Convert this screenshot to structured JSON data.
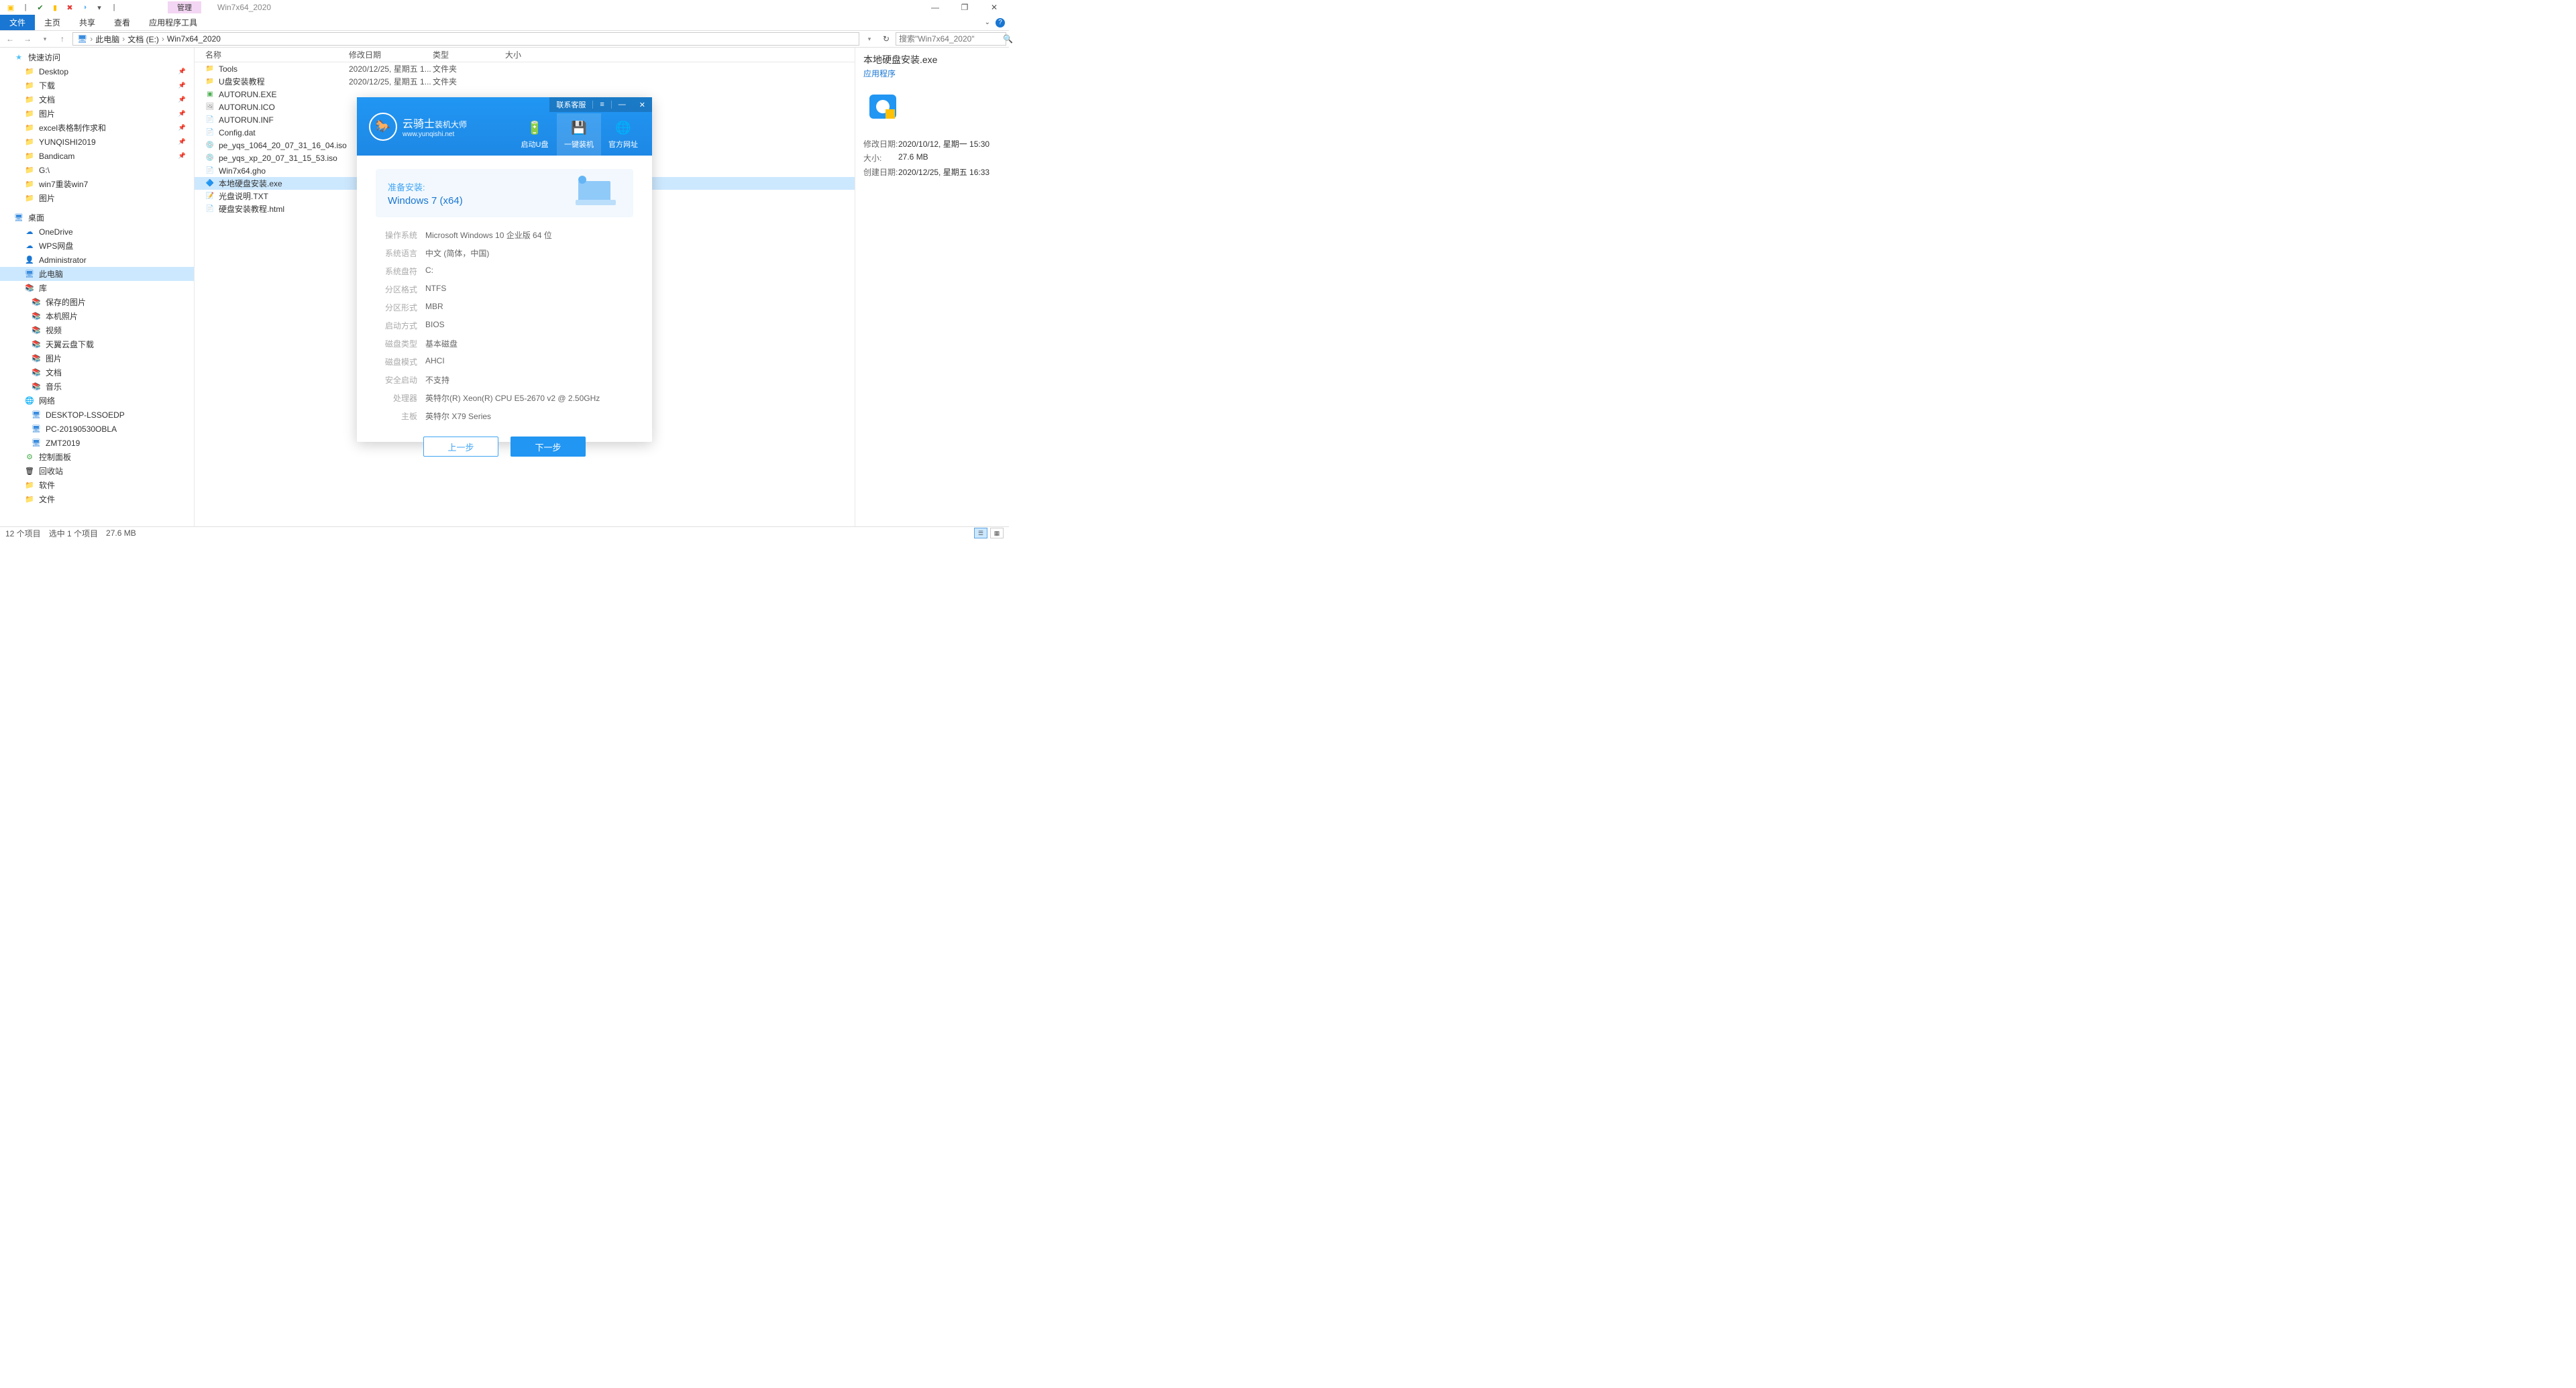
{
  "window": {
    "manage_tab": "管理",
    "title": "Win7x64_2020",
    "controls": {
      "minimize": "—",
      "maximize": "❐",
      "close": "✕"
    }
  },
  "ribbon": {
    "file": "文件",
    "home": "主页",
    "share": "共享",
    "view": "查看",
    "apptools": "应用程序工具"
  },
  "breadcrumb": {
    "pc": "此电脑",
    "drive": "文档 (E:)",
    "folder": "Win7x64_2020"
  },
  "search": {
    "placeholder": "搜索\"Win7x64_2020\""
  },
  "columns": {
    "name": "名称",
    "date": "修改日期",
    "type": "类型",
    "size": "大小"
  },
  "nav": {
    "quick": "快速访问",
    "quick_items": [
      {
        "label": "Desktop",
        "pin": true
      },
      {
        "label": "下载",
        "pin": true
      },
      {
        "label": "文档",
        "pin": true
      },
      {
        "label": "图片",
        "pin": true
      },
      {
        "label": "excel表格制作求和",
        "pin": true
      },
      {
        "label": "YUNQISHI2019",
        "pin": true
      },
      {
        "label": "Bandicam",
        "pin": true
      },
      {
        "label": "G:\\",
        "pin": false
      },
      {
        "label": "win7重装win7",
        "pin": false
      },
      {
        "label": "图片",
        "pin": false
      }
    ],
    "desktop": "桌面",
    "desktop_items": [
      "OneDrive",
      "WPS网盘",
      "Administrator",
      "此电脑",
      "库"
    ],
    "lib_items": [
      "保存的图片",
      "本机照片",
      "视频",
      "天翼云盘下载",
      "图片",
      "文档",
      "音乐"
    ],
    "network": "网络",
    "network_items": [
      "DESKTOP-LSSOEDP",
      "PC-20190530OBLA",
      "ZMT2019"
    ],
    "control_panel": "控制面板",
    "recycle": "回收站",
    "software": "软件",
    "files": "文件"
  },
  "files": [
    {
      "name": "Tools",
      "date": "2020/12/25, 星期五 1...",
      "type": "文件夹",
      "size": "",
      "icon": "folder"
    },
    {
      "name": "U盘安装教程",
      "date": "2020/12/25, 星期五 1...",
      "type": "文件夹",
      "size": "",
      "icon": "folder"
    },
    {
      "name": "AUTORUN.EXE",
      "date": "",
      "type": "",
      "size": "",
      "icon": "exe-green"
    },
    {
      "name": "AUTORUN.ICO",
      "date": "",
      "type": "",
      "size": "",
      "icon": "ico"
    },
    {
      "name": "AUTORUN.INF",
      "date": "",
      "type": "",
      "size": "",
      "icon": "inf"
    },
    {
      "name": "Config.dat",
      "date": "",
      "type": "",
      "size": "",
      "icon": "dat"
    },
    {
      "name": "pe_yqs_1064_20_07_31_16_04.iso",
      "date": "",
      "type": "",
      "size": "",
      "icon": "iso"
    },
    {
      "name": "pe_yqs_xp_20_07_31_15_53.iso",
      "date": "",
      "type": "",
      "size": "",
      "icon": "iso"
    },
    {
      "name": "Win7x64.gho",
      "date": "",
      "type": "",
      "size": "",
      "icon": "gho"
    },
    {
      "name": "本地硬盘安装.exe",
      "date": "",
      "type": "",
      "size": "",
      "icon": "exe-blue",
      "selected": true
    },
    {
      "name": "光盘说明.TXT",
      "date": "",
      "type": "",
      "size": "",
      "icon": "txt"
    },
    {
      "name": "硬盘安装教程.html",
      "date": "",
      "type": "",
      "size": "",
      "icon": "html"
    }
  ],
  "details": {
    "title": "本地硬盘安装.exe",
    "subtitle": "应用程序",
    "props": [
      {
        "label": "修改日期:",
        "value": "2020/10/12, 星期一 15:30"
      },
      {
        "label": "大小:",
        "value": "27.6 MB"
      },
      {
        "label": "创建日期:",
        "value": "2020/12/25, 星期五 16:33"
      }
    ]
  },
  "status": {
    "count": "12 个项目",
    "selected": "选中 1 个项目",
    "size": "27.6 MB"
  },
  "dialog": {
    "contact": "联系客服",
    "brand_main": "云骑士",
    "brand_suffix": "装机大师",
    "brand_url": "www.yunqishi.net",
    "nav1": "启动U盘",
    "nav2": "一键装机",
    "nav3": "官方网址",
    "prepare_label": "准备安装:",
    "prepare_os": "Windows 7 (x64)",
    "info": [
      {
        "label": "操作系统",
        "value": "Microsoft Windows 10 企业版 64 位"
      },
      {
        "label": "系统语言",
        "value": "中文 (简体，中国)"
      },
      {
        "label": "系统盘符",
        "value": "C:"
      },
      {
        "label": "分区格式",
        "value": "NTFS"
      },
      {
        "label": "分区形式",
        "value": "MBR"
      },
      {
        "label": "启动方式",
        "value": "BIOS"
      },
      {
        "label": "磁盘类型",
        "value": "基本磁盘"
      },
      {
        "label": "磁盘模式",
        "value": "AHCI"
      },
      {
        "label": "安全启动",
        "value": "不支持"
      },
      {
        "label": "处理器",
        "value": "英特尔(R) Xeon(R) CPU E5-2670 v2 @ 2.50GHz"
      },
      {
        "label": "主板",
        "value": "英特尔 X79 Series"
      }
    ],
    "btn_prev": "上一步",
    "btn_next": "下一步"
  }
}
